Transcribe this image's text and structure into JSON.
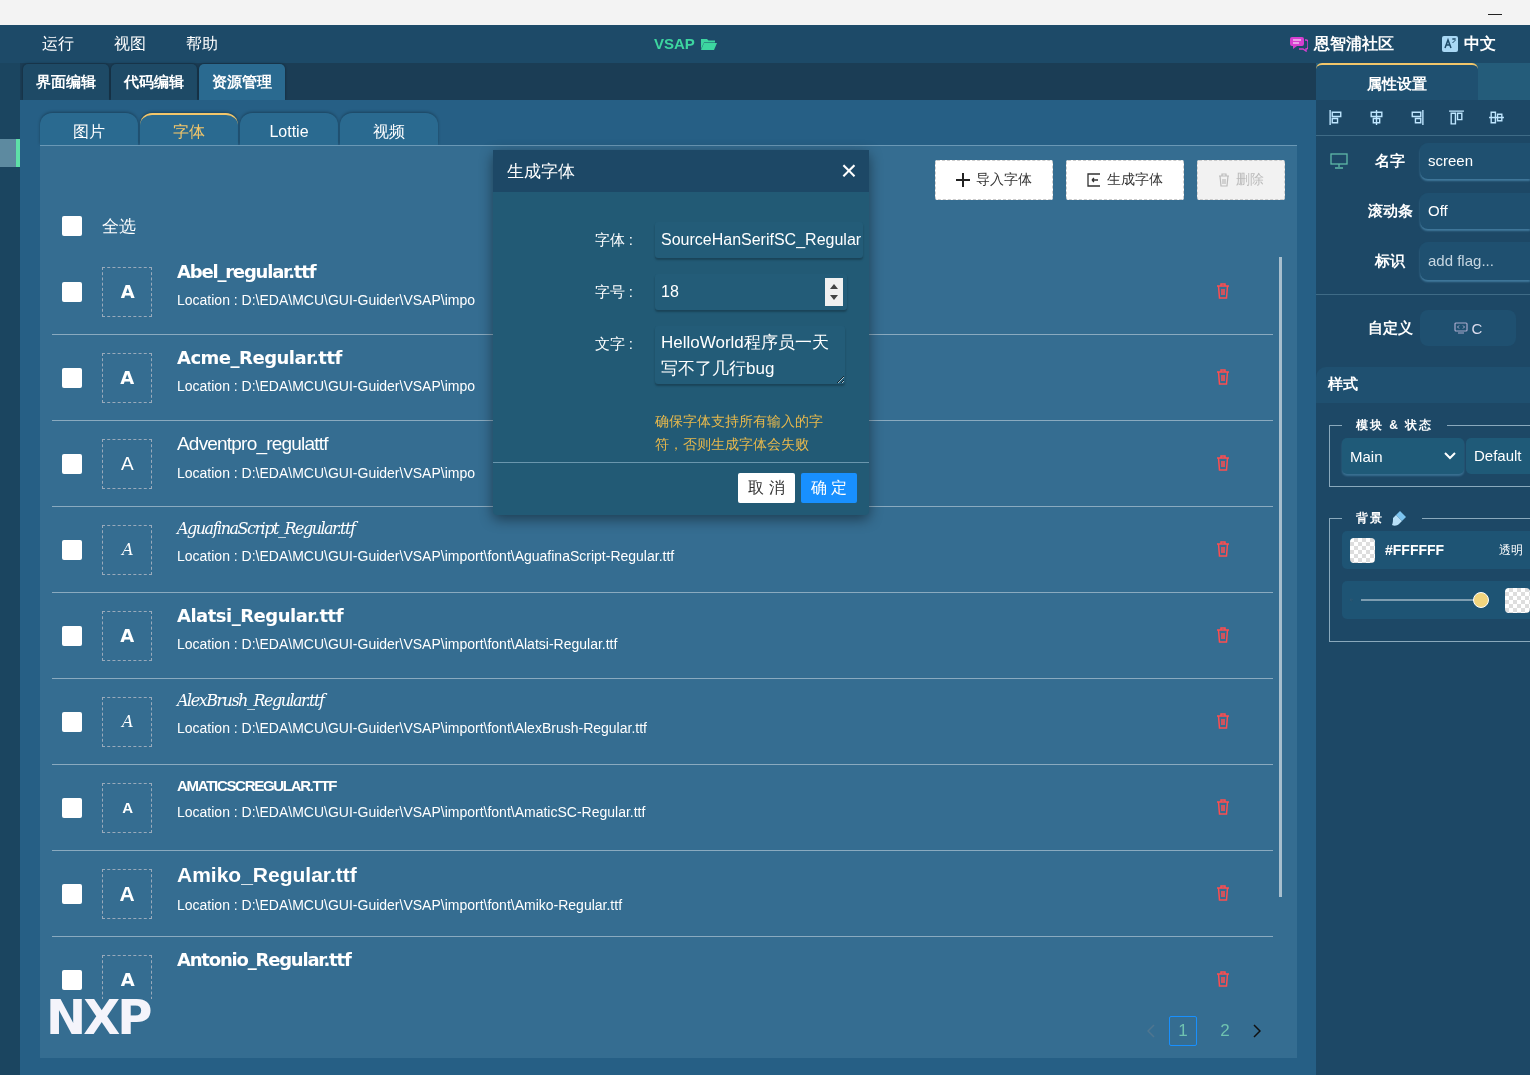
{
  "window": {
    "minimize": "—"
  },
  "menu": [
    "运行",
    "视图",
    "帮助"
  ],
  "app_title": "VSAP",
  "community": "恩智浦社区",
  "language": "中文",
  "editor_tabs": [
    {
      "label": "界面编辑",
      "selected": false
    },
    {
      "label": "代码编辑",
      "selected": false
    },
    {
      "label": "资源管理",
      "selected": true
    }
  ],
  "resource_tabs": [
    {
      "label": "图片",
      "selected": false
    },
    {
      "label": "字体",
      "selected": true
    },
    {
      "label": "Lottie",
      "selected": false
    },
    {
      "label": "视频",
      "selected": false
    }
  ],
  "toolbar": [
    {
      "label": "导入字体",
      "disabled": false
    },
    {
      "label": "生成字体",
      "disabled": false
    },
    {
      "label": "删除",
      "disabled": true
    }
  ],
  "select_all": {
    "label": "全选",
    "checked": false
  },
  "fonts": [
    {
      "name": "Abel_regular.ttf",
      "preview": "A",
      "location": "Location : D:\\EDA\\MCU\\GUI-Guider\\VSAP\\impo",
      "checked": false
    },
    {
      "name": "Acme_Regular.ttf",
      "preview": "A",
      "location": "Location : D:\\EDA\\MCU\\GUI-Guider\\VSAP\\impo",
      "checked": false
    },
    {
      "name": "Adventpro_regulattf",
      "preview": "A",
      "location": "Location : D:\\EDA\\MCU\\GUI-Guider\\VSAP\\impo",
      "checked": false
    },
    {
      "name": "AguafinaScript_Regular.ttf",
      "preview": "A",
      "location": "Location : D:\\EDA\\MCU\\GUI-Guider\\VSAP\\import\\font\\AguafinaScript-Regular.ttf",
      "checked": false
    },
    {
      "name": "Alatsi_Regular.ttf",
      "preview": "A",
      "location": "Location : D:\\EDA\\MCU\\GUI-Guider\\VSAP\\import\\font\\Alatsi-Regular.ttf",
      "checked": false
    },
    {
      "name": "AlexBrush_Regular.ttf",
      "preview": "A",
      "location": "Location : D:\\EDA\\MCU\\GUI-Guider\\VSAP\\import\\font\\AlexBrush-Regular.ttf",
      "checked": false
    },
    {
      "name": "AMATICSCREGULAR.TTF",
      "preview": "A",
      "location": "Location : D:\\EDA\\MCU\\GUI-Guider\\VSAP\\import\\font\\AmaticSC-Regular.ttf",
      "checked": false
    },
    {
      "name": "Amiko_Regular.ttf",
      "preview": "A",
      "location": "Location : D:\\EDA\\MCU\\GUI-Guider\\VSAP\\import\\font\\Amiko-Regular.ttf",
      "checked": false
    },
    {
      "name": "Antonio_Regular.ttf",
      "preview": "A",
      "checked": false
    }
  ],
  "pagination": [
    {
      "label": "1",
      "selected": true
    },
    {
      "label": "2",
      "selected": false
    }
  ],
  "logo": "NXP",
  "dialog": {
    "title": "生成字体",
    "close": "×",
    "fields": [
      {
        "kind": "text",
        "label": "字体 :",
        "value": "SourceHanSerifSC_Regular"
      },
      {
        "kind": "number",
        "label": "字号 :",
        "value": "18"
      },
      {
        "kind": "textarea",
        "label": "文字 :",
        "value": "HelloWorld程序员一天写不了几行bug"
      }
    ],
    "warning": "确保字体支持所有输入的字符，否则生成字体会失败",
    "buttons": [
      {
        "label": "取 消",
        "primary": false
      },
      {
        "label": "确 定",
        "primary": true
      }
    ]
  },
  "properties": {
    "tab": "属性设置",
    "rows": [
      {
        "kind": "screen",
        "label": "名字",
        "value": "screen"
      },
      {
        "kind": "field",
        "label": "滚动条",
        "value": "Off"
      },
      {
        "kind": "placeholder",
        "label": "标识",
        "placeholder": "add flag..."
      },
      {
        "kind": "button",
        "label": "自定义",
        "value": "C"
      }
    ],
    "style_title": "样式",
    "part_state": {
      "legend": "模块 & 状态",
      "part": "Main",
      "state": "Default"
    },
    "background": {
      "legend": "背景",
      "color": "#FFFFFF",
      "opacity_label": "透明",
      "level": 0.95
    }
  }
}
